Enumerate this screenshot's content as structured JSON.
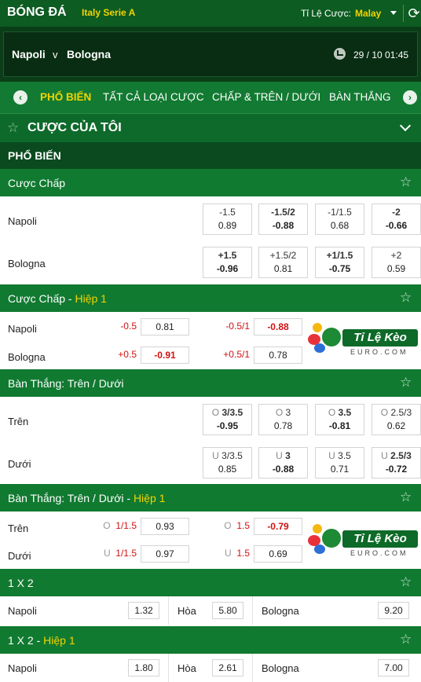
{
  "header": {
    "brand": "BÓNG ĐÁ",
    "league": "Italy Serie A",
    "odds_label": "Tỉ Lệ Cược:",
    "odds_value": "Malay"
  },
  "match": {
    "home": "Napoli",
    "vs": "v",
    "away": "Bologna",
    "datetime": "29 / 10  01:45"
  },
  "tabs": [
    "PHỔ BIẾN",
    "TẤT CẢ LOẠI CƯỢC",
    "CHẤP & TRÊN / DƯỚI",
    "BÀN THẮNG"
  ],
  "my_bets": "CƯỢC CỦA TÔI",
  "popular": "PHỔ BIẾN",
  "sections": {
    "handicap": {
      "title": "Cược Chấp",
      "rows": [
        {
          "team": "Napoli",
          "cells": [
            [
              "-1.5",
              "0.89"
            ],
            [
              "-1.5/2",
              "-0.88"
            ],
            [
              "-1/1.5",
              "0.68"
            ],
            [
              "-2",
              "-0.66"
            ]
          ]
        },
        {
          "team": "Bologna",
          "cells": [
            [
              "+1.5",
              "-0.96"
            ],
            [
              "+1.5/2",
              "0.81"
            ],
            [
              "+1/1.5",
              "-0.75"
            ],
            [
              "+2",
              "0.59"
            ]
          ]
        }
      ]
    },
    "handicap_h1": {
      "title": "Cược Chấp",
      "sub": "Hiệp 1",
      "rows": [
        {
          "team": "Napoli",
          "l1": "-0.5",
          "v1": "0.81",
          "l2": "-0.5/1",
          "v2": "-0.88"
        },
        {
          "team": "Bologna",
          "l1": "+0.5",
          "v1": "-0.91",
          "l2": "+0.5/1",
          "v2": "0.78"
        }
      ]
    },
    "ou": {
      "title": "Bàn Thắng: Trên / Dưới",
      "rows": [
        {
          "team": "Trên",
          "cells": [
            [
              "3/3.5",
              "-0.95"
            ],
            [
              "3",
              "0.78"
            ],
            [
              "3.5",
              "-0.81"
            ],
            [
              "2.5/3",
              "0.62"
            ]
          ]
        },
        {
          "team": "Dưới",
          "cells": [
            [
              "3/3.5",
              "0.85"
            ],
            [
              "3",
              "-0.88"
            ],
            [
              "3.5",
              "0.71"
            ],
            [
              "2.5/3",
              "-0.72"
            ]
          ]
        }
      ]
    },
    "ou_h1": {
      "title": "Bàn Thắng: Trên / Dưới",
      "sub": "Hiệp 1",
      "rows": [
        {
          "team": "Trên",
          "l1": "1/1.5",
          "v1": "0.93",
          "l2": "1.5",
          "v2": "-0.79"
        },
        {
          "team": "Dưới",
          "l1": "1/1.5",
          "v1": "0.97",
          "l2": "1.5",
          "v2": "0.69"
        }
      ]
    },
    "x12": {
      "title": "1 X 2",
      "home": "Napoli",
      "home_v": "1.32",
      "draw": "Hòa",
      "draw_v": "5.80",
      "away": "Bologna",
      "away_v": "9.20"
    },
    "x12_h1": {
      "title": "1 X 2",
      "sub": "Hiệp 1",
      "home": "Napoli",
      "home_v": "1.80",
      "draw": "Hòa",
      "draw_v": "2.61",
      "away": "Bologna",
      "away_v": "7.00"
    }
  },
  "ou_prefix": {
    "over": "O",
    "under": "U"
  },
  "watermark": {
    "text": "Tỉ Lệ Kèo",
    "sub": "EURO.COM"
  }
}
